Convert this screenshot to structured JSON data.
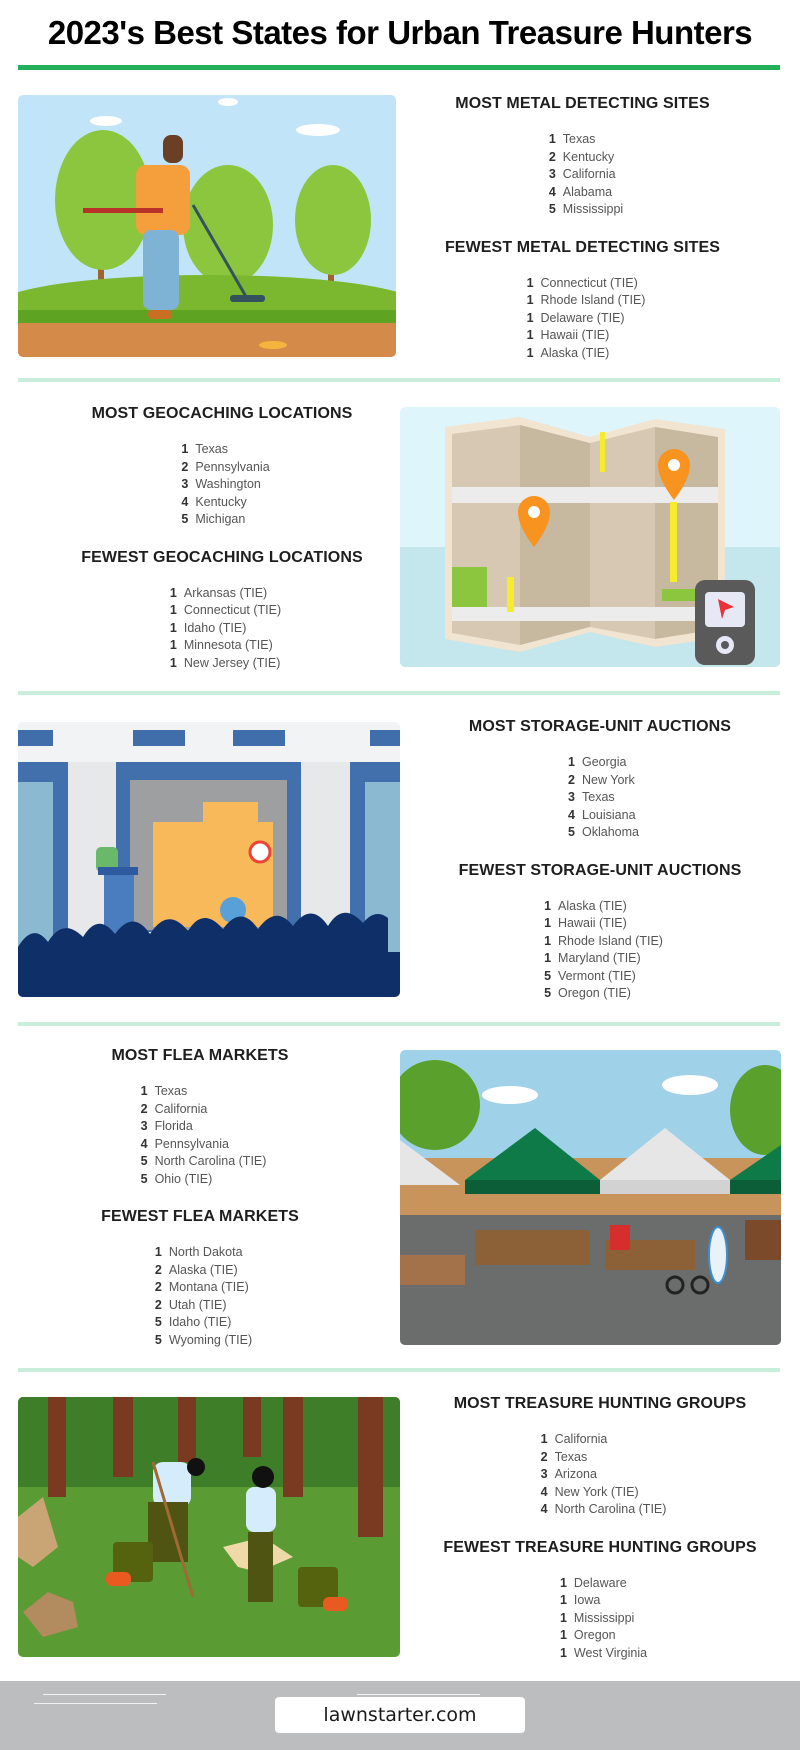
{
  "title": "2023's Best States for Urban Treasure Hunters",
  "colors": {
    "accent": "#22b05b",
    "divider": "#c9eedb",
    "footer_bg": "#bcbdbe"
  },
  "sections": [
    {
      "illustration": "metal-detecting-illustration",
      "most": {
        "heading": "MOST METAL DETECTING SITES",
        "items": [
          {
            "rank": "1",
            "state": "Texas"
          },
          {
            "rank": "2",
            "state": "Kentucky"
          },
          {
            "rank": "3",
            "state": "California"
          },
          {
            "rank": "4",
            "state": "Alabama"
          },
          {
            "rank": "5",
            "state": "Mississippi"
          }
        ]
      },
      "fewest": {
        "heading": "FEWEST METAL DETECTING SITES",
        "items": [
          {
            "rank": "1",
            "state": "Connecticut (TIE)"
          },
          {
            "rank": "1",
            "state": "Rhode Island (TIE)"
          },
          {
            "rank": "1",
            "state": "Delaware (TIE)"
          },
          {
            "rank": "1",
            "state": "Hawaii (TIE)"
          },
          {
            "rank": "1",
            "state": "Alaska (TIE)"
          }
        ]
      }
    },
    {
      "illustration": "geocaching-map-illustration",
      "most": {
        "heading": "MOST GEOCACHING LOCATIONS",
        "items": [
          {
            "rank": "1",
            "state": "Texas"
          },
          {
            "rank": "2",
            "state": "Pennsylvania"
          },
          {
            "rank": "3",
            "state": "Washington"
          },
          {
            "rank": "4",
            "state": "Kentucky"
          },
          {
            "rank": "5",
            "state": "Michigan"
          }
        ]
      },
      "fewest": {
        "heading": "FEWEST GEOCACHING LOCATIONS",
        "items": [
          {
            "rank": "1",
            "state": "Arkansas (TIE)"
          },
          {
            "rank": "1",
            "state": "Connecticut (TIE)"
          },
          {
            "rank": "1",
            "state": "Idaho (TIE)"
          },
          {
            "rank": "1",
            "state": "Minnesota (TIE)"
          },
          {
            "rank": "1",
            "state": "New Jersey (TIE)"
          }
        ]
      }
    },
    {
      "illustration": "storage-auction-illustration",
      "most": {
        "heading": "MOST STORAGE-UNIT AUCTIONS",
        "items": [
          {
            "rank": "1",
            "state": "Georgia"
          },
          {
            "rank": "2",
            "state": "New York"
          },
          {
            "rank": "3",
            "state": "Texas"
          },
          {
            "rank": "4",
            "state": "Louisiana"
          },
          {
            "rank": "5",
            "state": "Oklahoma"
          }
        ]
      },
      "fewest": {
        "heading": "FEWEST STORAGE-UNIT AUCTIONS",
        "items": [
          {
            "rank": "1",
            "state": "Alaska (TIE)"
          },
          {
            "rank": "1",
            "state": "Hawaii (TIE)"
          },
          {
            "rank": "1",
            "state": "Rhode Island (TIE)"
          },
          {
            "rank": "1",
            "state": "Maryland (TIE)"
          },
          {
            "rank": "5",
            "state": "Vermont (TIE)"
          },
          {
            "rank": "5",
            "state": "Oregon (TIE)"
          }
        ]
      }
    },
    {
      "illustration": "flea-market-illustration",
      "most": {
        "heading": "MOST FLEA MARKETS",
        "items": [
          {
            "rank": "1",
            "state": "Texas"
          },
          {
            "rank": "2",
            "state": "California"
          },
          {
            "rank": "3",
            "state": "Florida"
          },
          {
            "rank": "4",
            "state": "Pennsylvania"
          },
          {
            "rank": "5",
            "state": "North Carolina (TIE)"
          },
          {
            "rank": "5",
            "state": "Ohio (TIE)"
          }
        ]
      },
      "fewest": {
        "heading": "FEWEST FLEA MARKETS",
        "items": [
          {
            "rank": "1",
            "state": "North Dakota"
          },
          {
            "rank": "2",
            "state": "Alaska (TIE)"
          },
          {
            "rank": "2",
            "state": "Montana (TIE)"
          },
          {
            "rank": "2",
            "state": "Utah (TIE)"
          },
          {
            "rank": "5",
            "state": "Idaho (TIE)"
          },
          {
            "rank": "5",
            "state": "Wyoming (TIE)"
          }
        ]
      }
    },
    {
      "illustration": "treasure-hunting-group-illustration",
      "most": {
        "heading": "MOST TREASURE HUNTING GROUPS",
        "items": [
          {
            "rank": "1",
            "state": "California"
          },
          {
            "rank": "2",
            "state": "Texas"
          },
          {
            "rank": "3",
            "state": "Arizona"
          },
          {
            "rank": "4",
            "state": "New York (TIE)"
          },
          {
            "rank": "4",
            "state": "North Carolina (TIE)"
          }
        ]
      },
      "fewest": {
        "heading": "FEWEST TREASURE HUNTING GROUPS",
        "items": [
          {
            "rank": "1",
            "state": "Delaware"
          },
          {
            "rank": "1",
            "state": "Iowa"
          },
          {
            "rank": "1",
            "state": "Mississippi"
          },
          {
            "rank": "1",
            "state": "Oregon"
          },
          {
            "rank": "1",
            "state": "West Virginia"
          }
        ]
      }
    }
  ],
  "footer": {
    "brand": "lawnstarter.com"
  }
}
